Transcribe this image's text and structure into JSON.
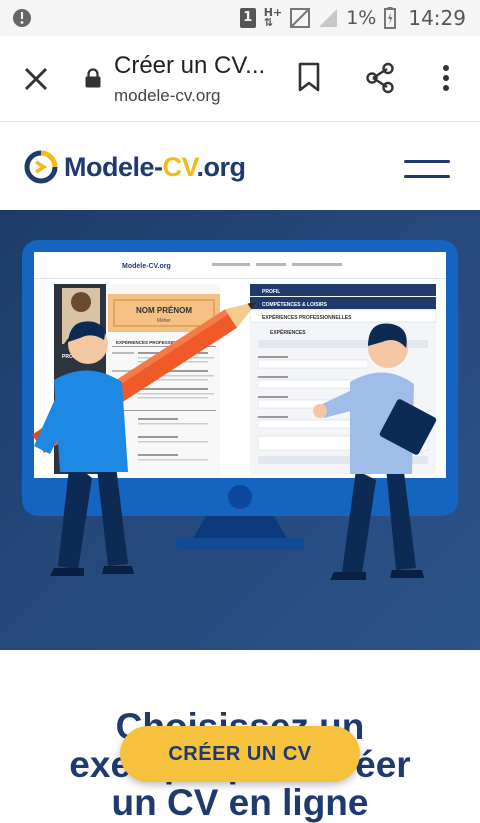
{
  "status_bar": {
    "sim_slot": "1",
    "network": "H+",
    "battery_percent": "1%",
    "time": "14:29"
  },
  "browser": {
    "page_title": "Créer un CV...",
    "url": "modele-cv.org"
  },
  "site": {
    "logo_main": "Modele-",
    "logo_accent": "CV",
    "logo_suffix": ".org",
    "colors": {
      "navy": "#1f3b6e",
      "yellow": "#f5b91c",
      "hero_bg": "#274a7e"
    }
  },
  "hero_preview": {
    "resume_name": "NOM PRÉNOM",
    "resume_job": "Métier",
    "resume_section": "EXPÉRIENCES PROFESSIONNELLES",
    "resume_profile": "PROFIL",
    "form_step1": "PROFIL",
    "form_step2": "COMPÉTENCES & LOISIRS",
    "form_step3": "EXPÉRIENCES PROFESSIONNELLES",
    "form_section": "EXPÉRIENCES"
  },
  "main": {
    "headline_line1": "Choisissez un",
    "headline_line2": "exemple pour créer",
    "headline_line3": "un CV en ligne",
    "cta_label": "CRÉER UN CV"
  }
}
